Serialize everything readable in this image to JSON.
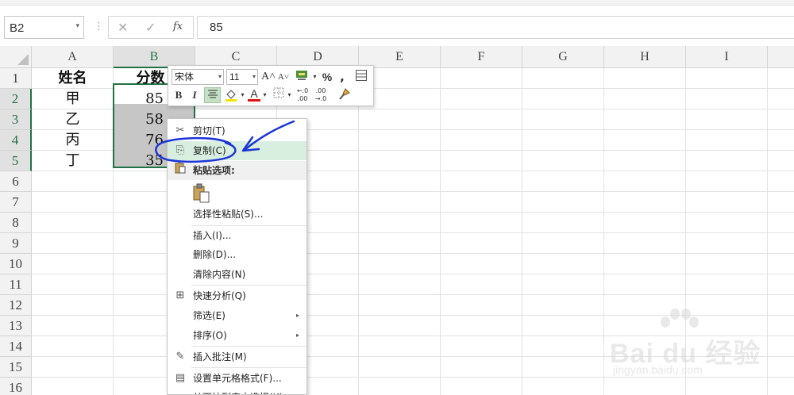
{
  "formula_bar": {
    "name_box": "B2",
    "name_box_arrow": "▾",
    "separator": "⋮",
    "cancel_icon": "✕",
    "enter_icon": "✓",
    "fx_label": "fx",
    "formula_value": "85"
  },
  "columns": [
    "A",
    "B",
    "C",
    "D",
    "E",
    "F",
    "G",
    "H",
    "I"
  ],
  "rows": [
    "1",
    "2",
    "3",
    "4",
    "5",
    "6",
    "7",
    "8",
    "9",
    "10",
    "11",
    "12",
    "13",
    "14",
    "15",
    "16"
  ],
  "cells": {
    "A1": "姓名",
    "B1": "分数",
    "A2": "甲",
    "B2": "85",
    "A3": "乙",
    "B3": "58",
    "A4": "丙",
    "B4": "76",
    "A5": "丁",
    "B5": "35"
  },
  "mini_toolbar": {
    "font_name": "宋体",
    "font_size": "11",
    "dropdown_arrow": "▾",
    "grow_font": "A˄",
    "shrink_font": "A˅",
    "percent": "%",
    "comma": ",",
    "bold": "B",
    "italic": "I",
    "font_color": "A",
    "increase_decimal": "←.0 .00",
    "decrease_decimal": ".00 →.0"
  },
  "context_menu": {
    "items": [
      {
        "label": "剪切(T)",
        "icon": "scissors-icon",
        "glyph": "✂"
      },
      {
        "label": "复制(C)",
        "icon": "copy-icon",
        "glyph": "⎘"
      },
      {
        "label": "粘贴选项:",
        "icon": "paste-icon",
        "glyph": "📋"
      },
      {
        "label": "选择性粘贴(S)..."
      },
      {
        "label": "插入(I)..."
      },
      {
        "label": "删除(D)..."
      },
      {
        "label": "清除内容(N)"
      },
      {
        "label": "快速分析(Q)",
        "icon": "quick-analysis-icon",
        "glyph": "⊞"
      },
      {
        "label": "筛选(E)",
        "submenu": "▸"
      },
      {
        "label": "排序(O)",
        "submenu": "▸"
      },
      {
        "label": "插入批注(M)",
        "icon": "comment-icon",
        "glyph": "✎"
      },
      {
        "label": "设置单元格格式(F)...",
        "icon": "format-cells-icon",
        "glyph": "▤"
      },
      {
        "label": "从下拉列表中选择(K)..."
      }
    ]
  },
  "watermark": {
    "brand": "Bai du 经验",
    "url": "jingyan.baidu.com"
  },
  "colors": {
    "selection_green": "#217346",
    "annotation_blue": "#1c35d8",
    "menu_hover": "#d8efe0"
  }
}
